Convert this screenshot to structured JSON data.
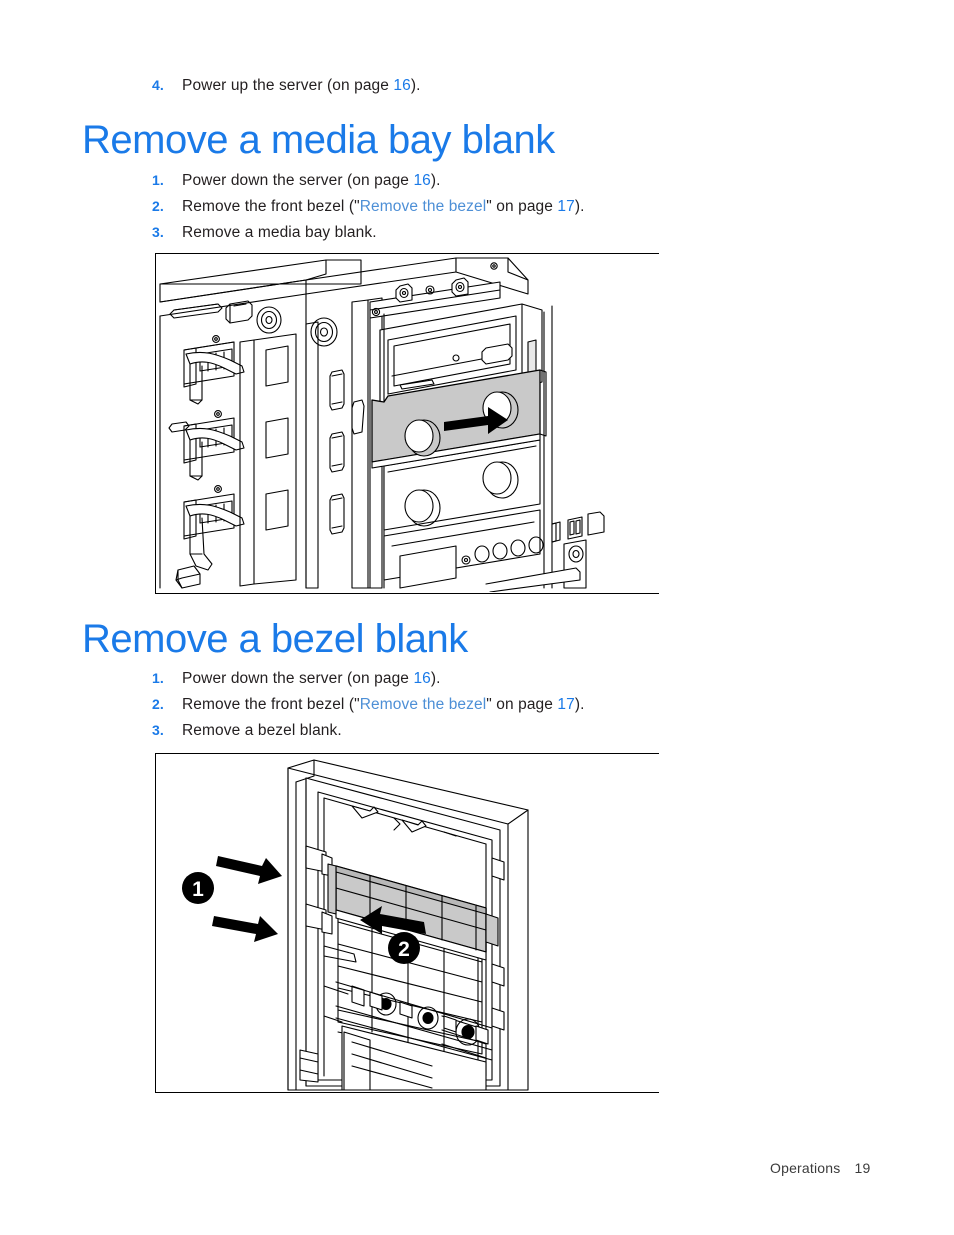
{
  "document": {
    "footer": {
      "section_label": "Operations",
      "page_number": "19"
    }
  },
  "intro_step": {
    "number": "4.",
    "text_before": "Power up the server (on page ",
    "page_ref": "16",
    "text_after": ")."
  },
  "sections": [
    {
      "id": "remove-a-media-bay-blank",
      "heading": "Remove a media bay blank",
      "steps": [
        {
          "number": "1.",
          "text_before": "Power down the server (on page ",
          "page_ref": "16",
          "text_after": ")."
        },
        {
          "number": "2.",
          "text_before": "Remove the front bezel (\"",
          "xref": "Remove the bezel",
          "text_mid": "\" on page ",
          "page_ref": "17",
          "text_after": ")."
        },
        {
          "number": "3.",
          "text_before": "Remove a media bay blank.",
          "page_ref": "",
          "text_after": ""
        }
      ],
      "figure": {
        "name": "media-bay-blank-removal-illustration",
        "description": "Line drawing of server chassis front interior showing a shaded media bay blank being pulled out",
        "callouts": [],
        "blank_fill": "#c9c9c9",
        "arrow_direction": "right"
      }
    },
    {
      "id": "remove-a-bezel-blank",
      "heading": "Remove a bezel blank",
      "steps": [
        {
          "number": "1.",
          "text_before": "Power down the server (on page ",
          "page_ref": "16",
          "text_after": ")."
        },
        {
          "number": "2.",
          "text_before": "Remove the front bezel (\"",
          "xref": "Remove the bezel",
          "text_mid": "\" on page ",
          "page_ref": "17",
          "text_after": ")."
        },
        {
          "number": "3.",
          "text_before": "Remove a bezel blank.",
          "page_ref": "",
          "text_after": ""
        }
      ],
      "figure": {
        "name": "bezel-blank-removal-illustration",
        "description": "Line drawing of the front bezel inner side showing a shaded bezel blank released by two latches and removed",
        "callouts": [
          "1",
          "2"
        ],
        "blank_fill": "#c9c9c9",
        "arrow_direction": "left"
      }
    }
  ],
  "colors": {
    "heading_blue": "#1a7ae8",
    "list_number_blue": "#1a7ae8",
    "xref_blue": "#4d8fd6",
    "body_text": "#231f20",
    "blank_gray": "#c9c9c9",
    "line_black": "#000000"
  }
}
